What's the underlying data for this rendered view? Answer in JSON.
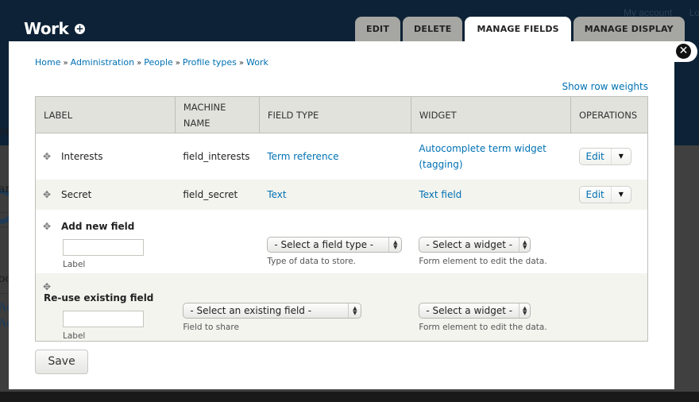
{
  "page": {
    "title": "Work",
    "title_icon": "add-shortcut-icon",
    "top_links": [
      "My account",
      "Log out"
    ]
  },
  "tabs": [
    {
      "label": "EDIT",
      "active": false
    },
    {
      "label": "DELETE",
      "active": false
    },
    {
      "label": "MANAGE FIELDS",
      "active": true
    },
    {
      "label": "MANAGE DISPLAY",
      "active": false
    }
  ],
  "dialog": {
    "close_icon": "close-icon",
    "breadcrumb": [
      "Home",
      "Administration",
      "People",
      "Profile types",
      "Work"
    ],
    "breadcrumb_separator": "»",
    "show_row_weights": "Show row weights",
    "table": {
      "headers": [
        "LABEL",
        "MACHINE NAME",
        "FIELD TYPE",
        "WIDGET",
        "OPERATIONS"
      ],
      "rows": [
        {
          "label": "Interests",
          "machine_name": "field_interests",
          "field_type": "Term reference",
          "widget": "Autocomplete term widget (tagging)",
          "operation": "Edit"
        },
        {
          "label": "Secret",
          "machine_name": "field_secret",
          "field_type": "Text",
          "widget": "Text field",
          "operation": "Edit"
        }
      ],
      "add_new": {
        "title": "Add new field",
        "label_input_value": "",
        "label_desc": "Label",
        "field_type_select": "- Select a field type -",
        "field_type_desc": "Type of data to store.",
        "widget_select": "- Select a widget -",
        "widget_desc": "Form element to edit the data."
      },
      "reuse": {
        "title": "Re-use existing field",
        "label_input_value": "",
        "label_desc": "Label",
        "existing_select": "- Select an existing field -",
        "existing_desc": "Field to share",
        "widget_select": "- Select a widget -",
        "widget_desc": "Form element to edit the data."
      }
    },
    "save_label": "Save"
  },
  "colors": {
    "header_bg": "#0d2236",
    "link": "#0071b3",
    "table_header_bg": "#e1e2dc",
    "even_row_bg": "#f3f4ee",
    "tab_inactive_bg": "#a6a6a2"
  }
}
